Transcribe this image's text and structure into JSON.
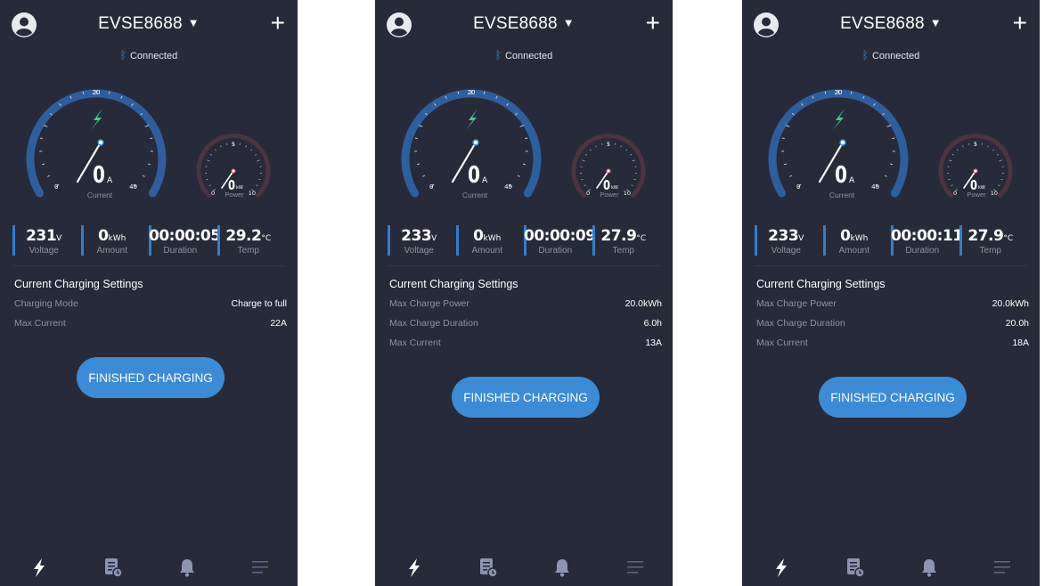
{
  "screens": [
    {
      "device_name": "EVSE8688",
      "connection_status": "Connected",
      "current_gauge": {
        "value": "0",
        "unit": "A",
        "label": "Current",
        "min_label": "0",
        "mid_label": "20",
        "max_label": "40",
        "fraction": 0.0
      },
      "power_gauge": {
        "value": "0",
        "unit": "kW",
        "label": "Power",
        "min_label": "0",
        "mid_label": "5",
        "max_label": "10",
        "fraction": 0.0
      },
      "stats": [
        {
          "value": "231",
          "unit": "V",
          "label": "Voltage"
        },
        {
          "value": "0",
          "unit": "kWh",
          "label": "Amount"
        },
        {
          "value": "00:00:05",
          "unit": "",
          "label": "Duration"
        },
        {
          "value": "29.2",
          "unit": "°C",
          "label": "Temp"
        }
      ],
      "settings_title": "Current Charging Settings",
      "settings": [
        {
          "label": "Charging Mode",
          "value": "Charge to full"
        },
        {
          "label": "Max Current",
          "value": "22A"
        }
      ],
      "finish_button": "FINISHED CHARGING"
    },
    {
      "device_name": "EVSE8688",
      "connection_status": "Connected",
      "current_gauge": {
        "value": "0",
        "unit": "A",
        "label": "Current",
        "min_label": "0",
        "mid_label": "20",
        "max_label": "40",
        "fraction": 0.0
      },
      "power_gauge": {
        "value": "0",
        "unit": "kW",
        "label": "Power",
        "min_label": "0",
        "mid_label": "5",
        "max_label": "10",
        "fraction": 0.0
      },
      "stats": [
        {
          "value": "233",
          "unit": "V",
          "label": "Voltage"
        },
        {
          "value": "0",
          "unit": "kWh",
          "label": "Amount"
        },
        {
          "value": "00:00:09",
          "unit": "",
          "label": "Duration"
        },
        {
          "value": "27.9",
          "unit": "°C",
          "label": "Temp"
        }
      ],
      "settings_title": "Current Charging Settings",
      "settings": [
        {
          "label": "Max Charge Power",
          "value": "20.0kWh"
        },
        {
          "label": "Max Charge Duration",
          "value": "6.0h"
        },
        {
          "label": "Max Current",
          "value": "13A"
        }
      ],
      "finish_button": "FINISHED CHARGING"
    },
    {
      "device_name": "EVSE8688",
      "connection_status": "Connected",
      "current_gauge": {
        "value": "0",
        "unit": "A",
        "label": "Current",
        "min_label": "0",
        "mid_label": "20",
        "max_label": "40",
        "fraction": 0.0
      },
      "power_gauge": {
        "value": "0",
        "unit": "kW",
        "label": "Power",
        "min_label": "0",
        "mid_label": "5",
        "max_label": "10",
        "fraction": 0.0
      },
      "stats": [
        {
          "value": "233",
          "unit": "V",
          "label": "Voltage"
        },
        {
          "value": "0",
          "unit": "kWh",
          "label": "Amount"
        },
        {
          "value": "00:00:11",
          "unit": "",
          "label": "Duration"
        },
        {
          "value": "27.9",
          "unit": "°C",
          "label": "Temp"
        }
      ],
      "settings_title": "Current Charging Settings",
      "settings": [
        {
          "label": "Max Charge Power",
          "value": "20.0kWh"
        },
        {
          "label": "Max Charge Duration",
          "value": "20.0h"
        },
        {
          "label": "Max Current",
          "value": "18A"
        }
      ],
      "finish_button": "FINISHED CHARGING"
    }
  ],
  "icons": {
    "avatar": "user-avatar-icon",
    "add": "plus-icon",
    "bluetooth": "bluetooth-icon",
    "bolt": "lightning-bolt-icon",
    "nav": [
      "charging-icon",
      "records-icon",
      "notification-bell-icon",
      "menu-icon"
    ]
  },
  "colors": {
    "background": "#272a38",
    "accent_blue": "#3b8bd6",
    "gauge_arc": "#2d5f9e",
    "power_arc": "#4a3440",
    "bolt_green": "#3ecf8e",
    "muted_text": "#8d92a6"
  }
}
